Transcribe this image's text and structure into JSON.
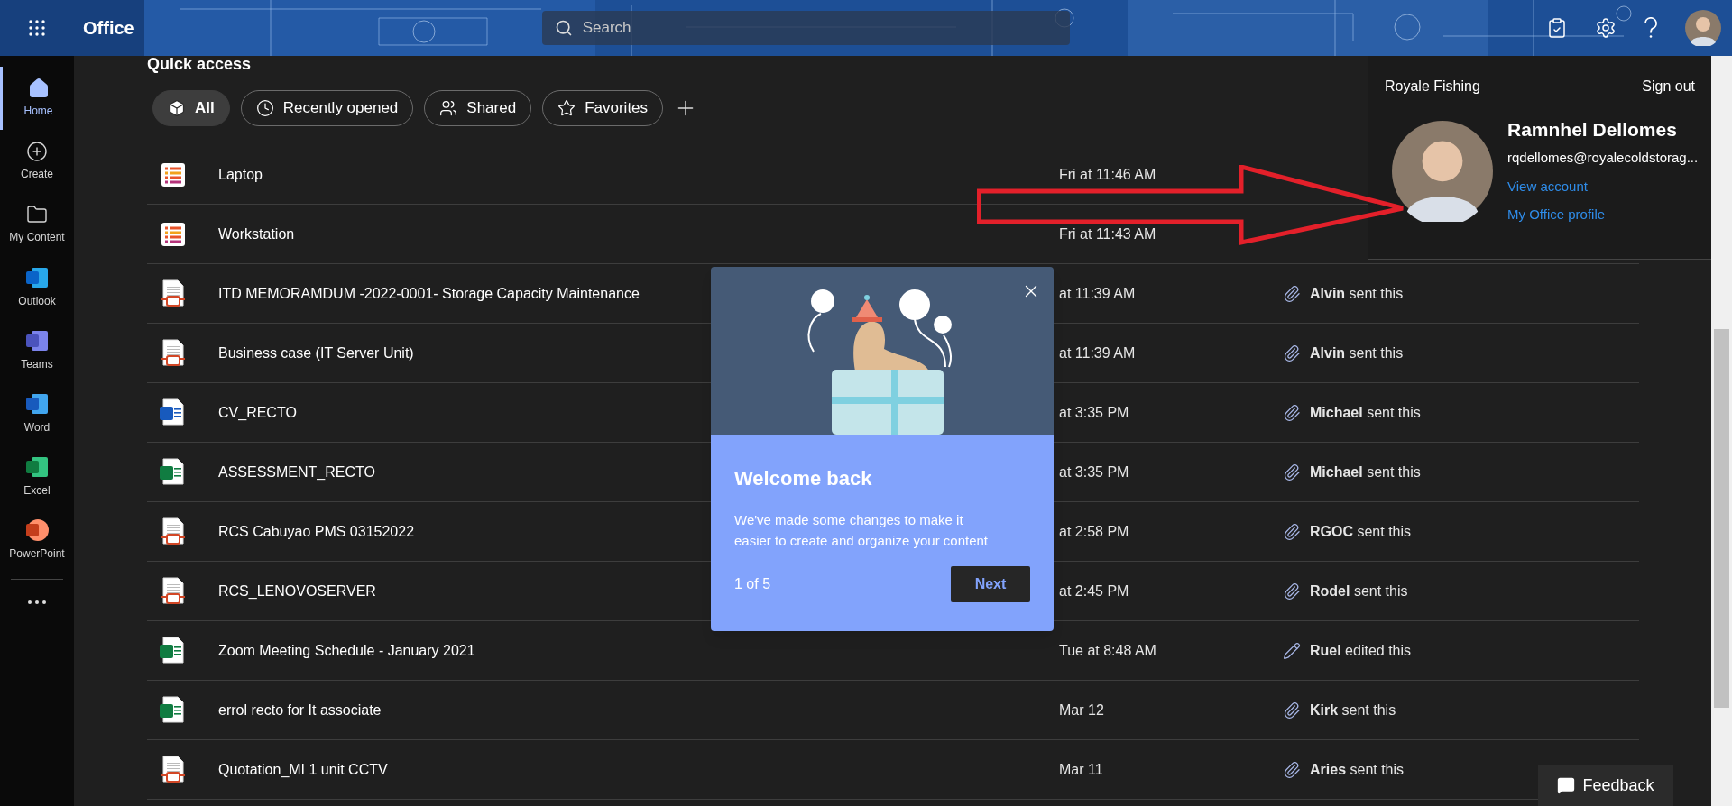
{
  "top_bar": {
    "app_name": "Office",
    "search": {
      "placeholder": "Search"
    }
  },
  "sidebar": {
    "items": [
      {
        "label": "Home",
        "kind": "home",
        "selected": true
      },
      {
        "label": "Create",
        "kind": "create",
        "selected": false
      },
      {
        "label": "My Content",
        "kind": "folder",
        "selected": false
      },
      {
        "label": "Outlook",
        "kind": "outlook",
        "selected": false
      },
      {
        "label": "Teams",
        "kind": "teams",
        "selected": false
      },
      {
        "label": "Word",
        "kind": "word",
        "selected": false
      },
      {
        "label": "Excel",
        "kind": "excel",
        "selected": false
      },
      {
        "label": "PowerPoint",
        "kind": "powerpoint",
        "selected": false
      }
    ]
  },
  "quick_access": {
    "title": "Quick access",
    "filters": [
      {
        "label": "All",
        "kind": "all",
        "selected": true
      },
      {
        "label": "Recently opened",
        "kind": "recent",
        "selected": false
      },
      {
        "label": "Shared",
        "kind": "shared",
        "selected": false
      },
      {
        "label": "Favorites",
        "kind": "favorites",
        "selected": false
      }
    ]
  },
  "files": [
    {
      "name": "Laptop",
      "kind": "list",
      "date": "Fri at 11:46 AM"
    },
    {
      "name": "Workstation",
      "kind": "list",
      "date": "Fri at 11:43 AM"
    },
    {
      "name": "ITD MEMORAMDUM -2022-0001- Storage Capacity Maintenance",
      "kind": "pdf",
      "date": "at 11:39 AM",
      "activity": {
        "text": "**Alvin** sent this",
        "kind": "sent"
      }
    },
    {
      "name": "Business case (IT Server Unit)",
      "kind": "pdf",
      "date": "at 11:39 AM",
      "activity": {
        "text": "**Alvin** sent this",
        "kind": "sent"
      }
    },
    {
      "name": "CV_RECTO",
      "kind": "word",
      "date": "at 3:35 PM",
      "activity": {
        "text": "**Michael** sent this",
        "kind": "sent"
      }
    },
    {
      "name": "ASSESSMENT_RECTO",
      "kind": "excel",
      "date": "at 3:35 PM",
      "activity": {
        "text": "**Michael** sent this",
        "kind": "sent"
      }
    },
    {
      "name": "RCS Cabuyao PMS 03152022",
      "kind": "pdf",
      "date": "at 2:58 PM",
      "activity": {
        "text": "**RGOC** sent this",
        "kind": "sent"
      }
    },
    {
      "name": "RCS_LENOVOSERVER",
      "kind": "pdf",
      "date": "at 2:45 PM",
      "activity": {
        "text": "**Rodel** sent this",
        "kind": "sent"
      }
    },
    {
      "name": "Zoom Meeting Schedule - January 2021",
      "kind": "excel",
      "date": "Tue at 8:48 AM",
      "activity": {
        "text": "**Ruel** edited this",
        "kind": "edited"
      }
    },
    {
      "name": "errol recto for It associate",
      "kind": "excel",
      "date": "Mar 12",
      "activity": {
        "text": "**Kirk** sent this",
        "kind": "sent"
      }
    },
    {
      "name": "Quotation_MI 1 unit CCTV",
      "kind": "pdf",
      "date": "Mar 11",
      "activity": {
        "text": "**Aries** sent this",
        "kind": "sent"
      }
    }
  ],
  "account": {
    "org": "Royale Fishing",
    "sign_out": "Sign out",
    "name": "Ramnhel Dellomes",
    "email": "rqdellomes@royalecoldstorag...",
    "links": [
      "View account",
      "My Office profile"
    ]
  },
  "welcome": {
    "title": "Welcome back",
    "body": "We've made some changes to make it easier to create and organize your content",
    "step": "1 of 5",
    "next": "Next"
  },
  "feedback": "Feedback"
}
